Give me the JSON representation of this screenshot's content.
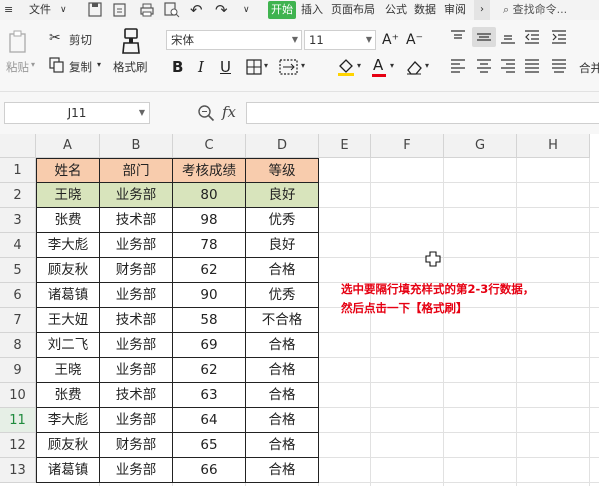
{
  "menubar": {
    "menu_icon": "hamburger-icon",
    "file_label": "文件",
    "tabs": [
      "开始",
      "插入",
      "页面布局",
      "公式",
      "数据",
      "审阅"
    ],
    "more_icon": "chevron-right-icon",
    "search_label": "查找命令..."
  },
  "ribbon": {
    "paste_label": "粘贴",
    "cut_label": "剪切",
    "copy_label": "复制",
    "format_painter_label": "格式刷",
    "font_name": "宋体",
    "font_size": "11",
    "merge_label": "合并"
  },
  "formula_bar": {
    "name_box": "J11",
    "fx_label": "fx",
    "formula": ""
  },
  "sheet": {
    "columns": [
      "A",
      "B",
      "C",
      "D",
      "E",
      "F",
      "G",
      "H"
    ],
    "rows": [
      "1",
      "2",
      "3",
      "4",
      "5",
      "6",
      "7",
      "8",
      "9",
      "10",
      "11",
      "12",
      "13"
    ],
    "selected_row": "11",
    "table": {
      "headers": [
        "姓名",
        "部门",
        "考核成绩",
        "等级"
      ],
      "header_color": "#f8ccad",
      "highlight_color": "#d8e4bc",
      "rows": [
        [
          "王晓",
          "业务部",
          "80",
          "良好"
        ],
        [
          "张费",
          "技术部",
          "98",
          "优秀"
        ],
        [
          "李大彪",
          "业务部",
          "78",
          "良好"
        ],
        [
          "顾友秋",
          "财务部",
          "62",
          "合格"
        ],
        [
          "诸葛镇",
          "业务部",
          "90",
          "优秀"
        ],
        [
          "王大妞",
          "技术部",
          "58",
          "不合格"
        ],
        [
          "刘二飞",
          "业务部",
          "69",
          "合格"
        ],
        [
          "王晓",
          "业务部",
          "62",
          "合格"
        ],
        [
          "张费",
          "技术部",
          "63",
          "合格"
        ],
        [
          "李大彪",
          "业务部",
          "64",
          "合格"
        ],
        [
          "顾友秋",
          "财务部",
          "65",
          "合格"
        ],
        [
          "诸葛镇",
          "业务部",
          "66",
          "合格"
        ]
      ]
    },
    "annotation_line1": "选中要隔行填充样式的第2-3行数据，",
    "annotation_line2": "然后点击一下【格式刷】",
    "annotation_color": "#e60012",
    "cursor_icon": "cell-select-cursor-icon"
  }
}
